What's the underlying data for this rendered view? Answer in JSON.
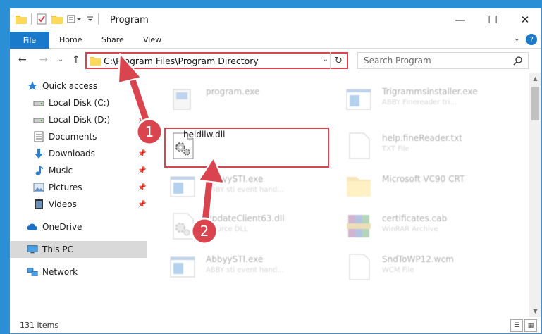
{
  "window": {
    "title": "Program",
    "controls": {
      "minimize": "—",
      "maximize": "☐",
      "close": "✕"
    }
  },
  "ribbon": {
    "tabs": [
      "File",
      "Home",
      "Share",
      "View"
    ],
    "help": "?",
    "collapse": "⌄"
  },
  "navigation": {
    "back": "←",
    "forward": "→",
    "recent": "⌄",
    "up": "↑",
    "address": "C:\\Program Files\\Program Directory",
    "address_dropdown": "⌄",
    "refresh": "↻",
    "search_placeholder": "Search Program"
  },
  "nav_pane": {
    "items": [
      {
        "label": "Quick access",
        "icon": "star-icon",
        "pinned": false
      },
      {
        "label": "Local Disk (C:)",
        "icon": "drive-icon",
        "pinned": false
      },
      {
        "label": "Local Disk (D:)",
        "icon": "drive-icon",
        "pinned": true
      },
      {
        "label": "Documents",
        "icon": "documents-icon",
        "pinned": true
      },
      {
        "label": "Downloads",
        "icon": "download-icon",
        "pinned": true
      },
      {
        "label": "Music",
        "icon": "music-icon",
        "pinned": true
      },
      {
        "label": "Pictures",
        "icon": "pictures-icon",
        "pinned": true
      },
      {
        "label": "Videos",
        "icon": "videos-icon",
        "pinned": true
      },
      {
        "label": "OneDrive",
        "icon": "cloud-icon",
        "pinned": false
      },
      {
        "label": "This PC",
        "icon": "computer-icon",
        "pinned": false,
        "selected": true
      },
      {
        "label": "Network",
        "icon": "network-icon",
        "pinned": false
      }
    ],
    "pin_glyph": "📌"
  },
  "files": [
    {
      "name": "program.exe",
      "type": "",
      "icon": "exe-icon",
      "faded": true
    },
    {
      "name": "Trigrammsinstaller.exe",
      "type": "ABBY Finereader tri...",
      "icon": "window-icon",
      "faded": true
    },
    {
      "name": "heidilw.dll",
      "type": "",
      "icon": "gear-file-icon",
      "faded": false
    },
    {
      "name": "help.fineReader.txt",
      "type": "TXT File",
      "icon": "blank-file-icon",
      "faded": true
    },
    {
      "name": "AbbyySTI.exe",
      "type": "ABBY sti event hand...",
      "icon": "window-icon",
      "faded": true
    },
    {
      "name": "Microsoft VC90 CRT",
      "type": "",
      "icon": "folder-icon",
      "faded": true
    },
    {
      "name": "UpdateClient63.dll",
      "type": "...ource DLL",
      "icon": "gear-file-icon",
      "faded": true
    },
    {
      "name": "certificates.cab",
      "type": "WinRAR Archive",
      "icon": "archive-icon",
      "faded": true
    },
    {
      "name": "AbbyySTI.exe",
      "type": "ABBY sti event hand...",
      "icon": "window-icon",
      "faded": true
    },
    {
      "name": "SndToWP12.wcm",
      "type": "WCM File",
      "icon": "blank-file-icon",
      "faded": true
    }
  ],
  "status": {
    "item_count": "131 items"
  },
  "annotations": {
    "step1": "1",
    "step2": "2",
    "color": "#d9444f"
  },
  "colors": {
    "accent": "#1979ca",
    "highlight": "#d9444f",
    "desktop": "#2b8fd6"
  }
}
